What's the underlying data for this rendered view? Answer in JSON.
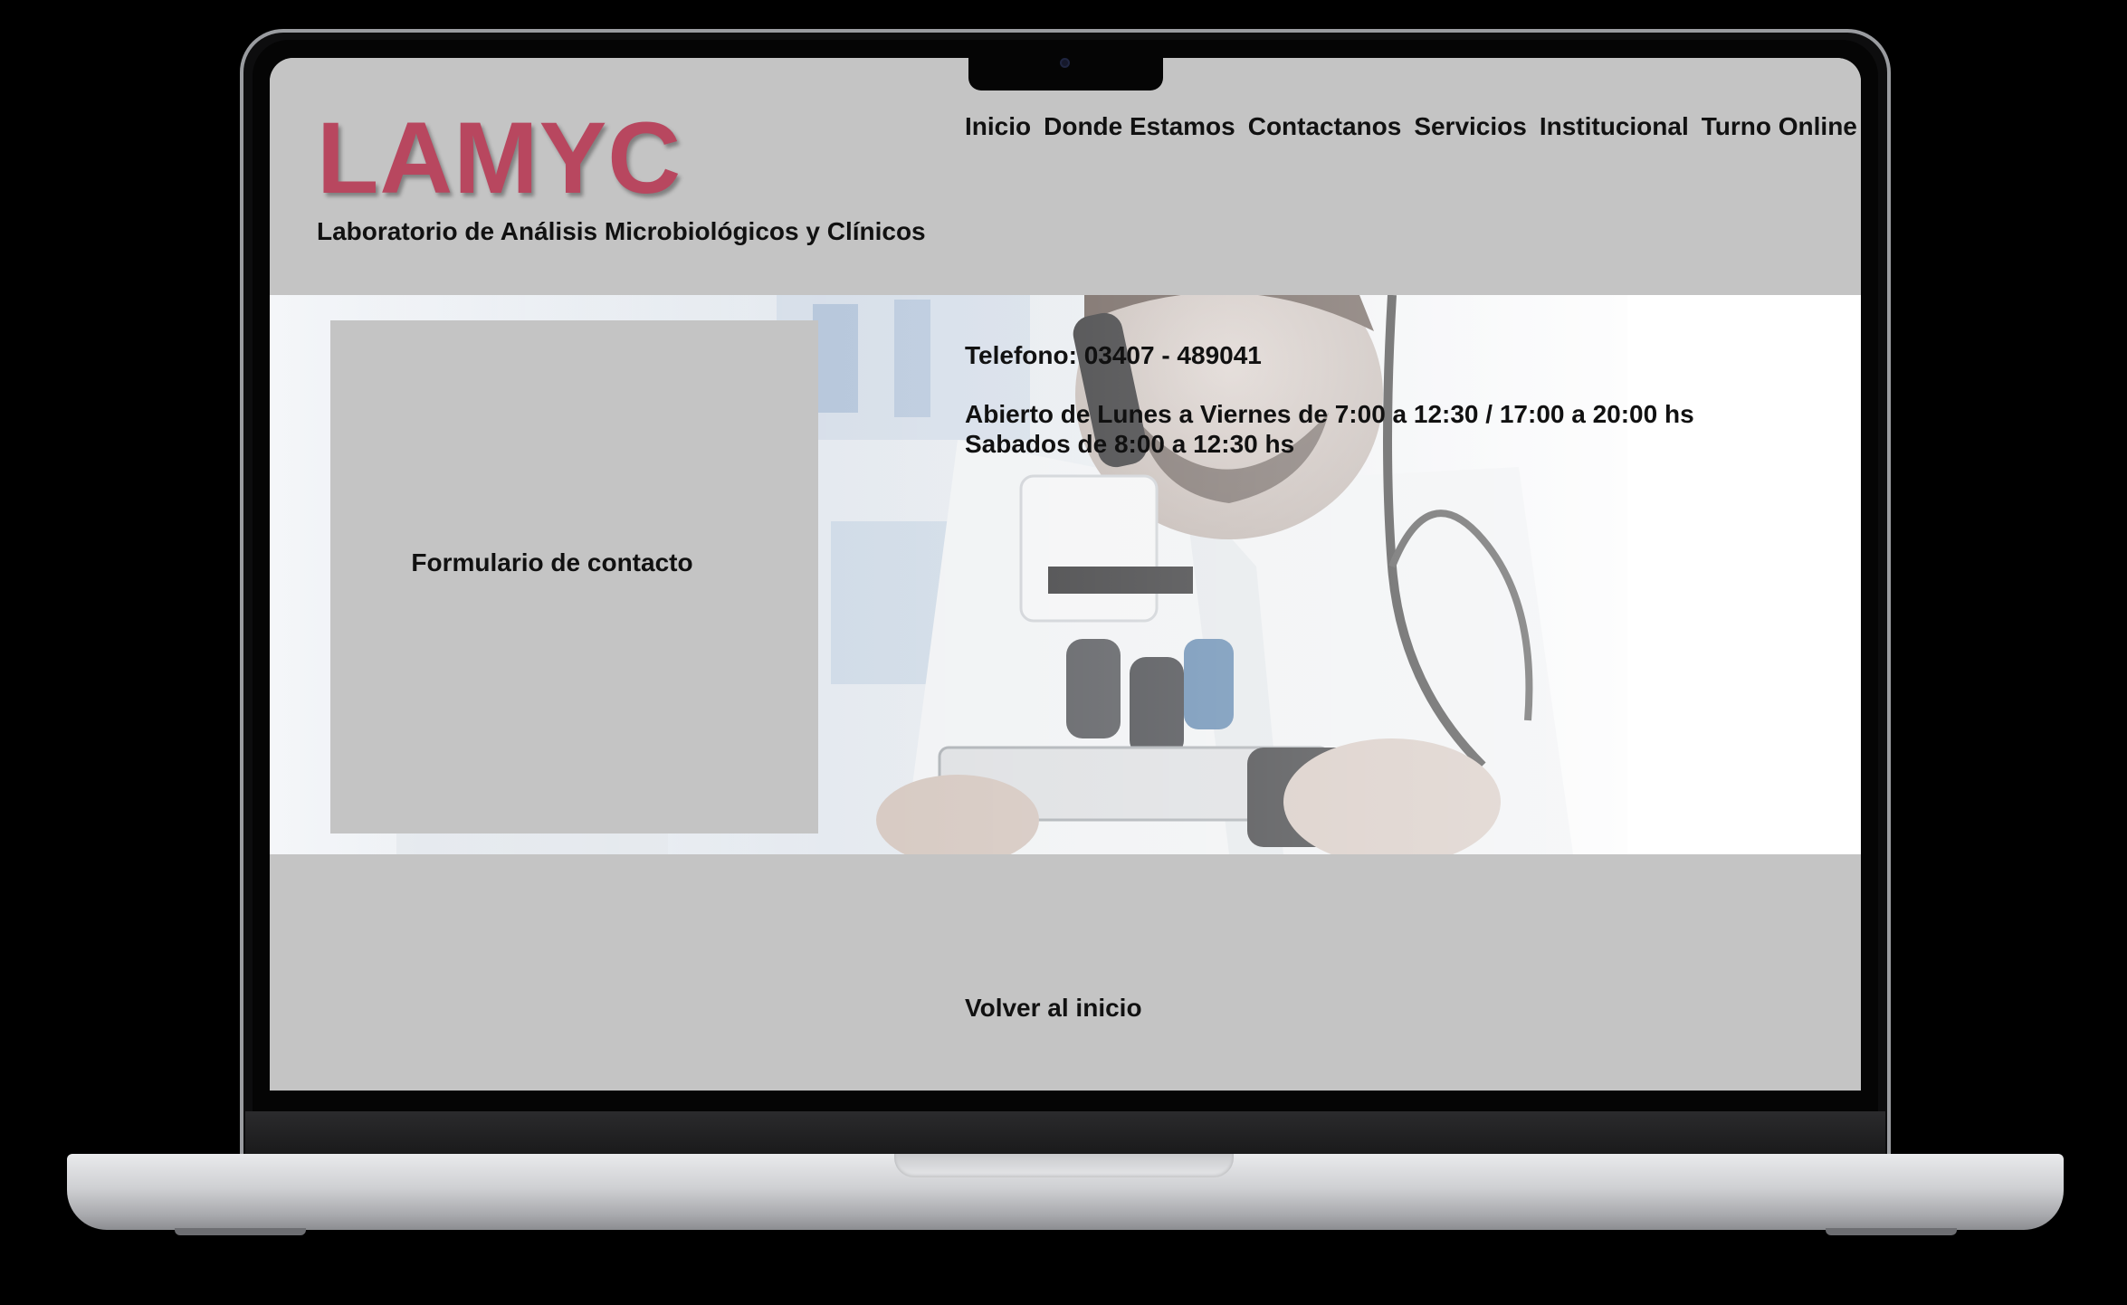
{
  "site": {
    "logo": "LAMYC",
    "subtitle": "Laboratorio de Análisis Microbiológicos y Clínicos"
  },
  "nav": {
    "items": [
      "Inicio",
      "Donde Estamos",
      "Contactanos",
      "Servicios",
      "Institucional",
      "Turno Online"
    ]
  },
  "contact": {
    "form_label": "Formulario de contacto",
    "phone": "Telefono: 03407 - 489041",
    "hours_weekdays": "Abierto de Lunes a Viernes de 7:00 a 12:30 / 17:00 a 20:00 hs",
    "hours_saturday": "Sabados de 8:00 a 12:30 hs"
  },
  "footer": {
    "back_link": "Volver al inicio"
  },
  "colors": {
    "logo": "#b8475f",
    "panel_gray": "#c4c4c4",
    "text": "#111111"
  }
}
